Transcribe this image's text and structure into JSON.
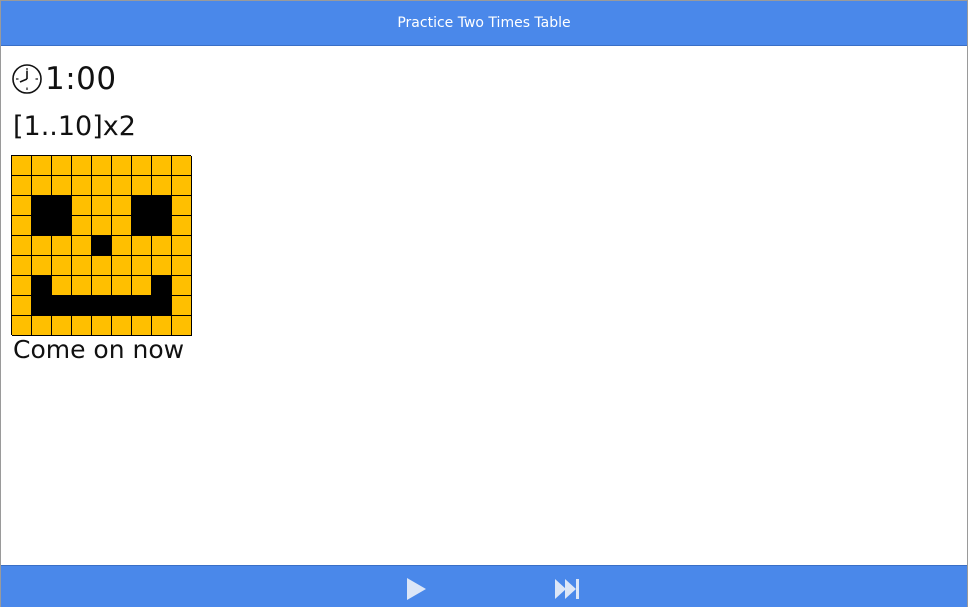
{
  "window": {
    "title": "Practice Two Times Table"
  },
  "timer": {
    "icon": "clock-icon",
    "value": "1:00"
  },
  "exercise": {
    "range_label": "[1..10]x2"
  },
  "face": {
    "colors": {
      "face": "#ffbf00",
      "feature": "#000000",
      "grid_line": "#000000"
    },
    "pattern": [
      "yyyyyyyyy",
      "yyyyyyyyy",
      "ybbyyybby",
      "ybbyyybby",
      "yyyybyyyy",
      "yyyyyyyyy",
      "ybyyyyyby",
      "ybbbbbbby",
      "yyyyyyyyy"
    ]
  },
  "message": "Come on now",
  "controls": {
    "play": {
      "icon": "play-icon"
    },
    "skip": {
      "icon": "skip-forward-icon"
    }
  },
  "colors": {
    "bar": "#4a88ea",
    "bar_text": "#ffffff",
    "control_icon": "#dce6f7"
  }
}
